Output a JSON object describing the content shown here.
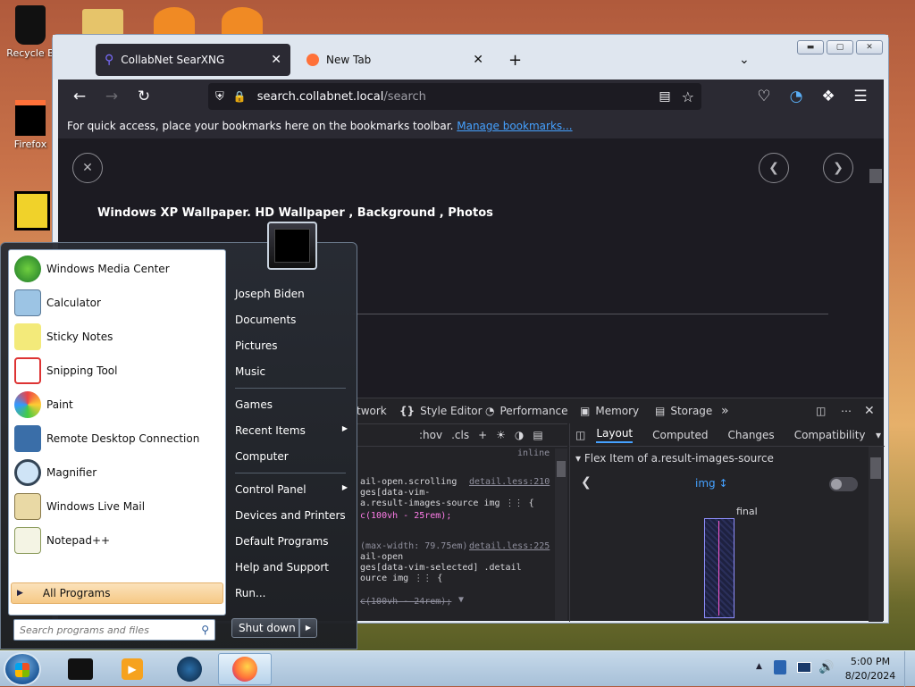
{
  "desktop": {
    "icons": [
      {
        "label": "Recycle B",
        "icon": "recycle-bin-icon"
      },
      {
        "label": "Firefox",
        "icon": "firefox-icon"
      }
    ]
  },
  "browser": {
    "tabs": [
      {
        "label": "CollabNet SearXNG",
        "active": true
      },
      {
        "label": "New Tab",
        "active": false
      }
    ],
    "new_tab": "+",
    "url_host": "search.collabnet.local",
    "url_path": "/search",
    "bookmarks_text": "For quick access, place your bookmarks here on the bookmarks toolbar.",
    "bookmarks_link": "Manage bookmarks...",
    "result_title": "Windows XP Wallpaper. HD Wallpaper , Background , Photos"
  },
  "devtools": {
    "tabs": [
      "twork",
      "Style Editor",
      "Performance",
      "Memory",
      "Storage"
    ],
    "toolbar": [
      ":hov",
      ".cls"
    ],
    "inline": "inline",
    "rules": [
      {
        "sel": "ail-open.scrolling",
        "src": "detail.less:210"
      },
      {
        "sel": "ges[data-vim-",
        "src": ""
      },
      {
        "sel": "a.result-images-source img ⋮⋮ {",
        "src": ""
      },
      {
        "sel": "c(100vh - 25rem);",
        "src": ""
      },
      {
        "sel": "(max-width: 79.75em)",
        "src": "detail.less:225"
      },
      {
        "sel": "ail-open",
        "src": ""
      },
      {
        "sel": "ges[data-vim-selected] .detail",
        "src": ""
      },
      {
        "sel": "ource img ⋮⋮ {",
        "src": ""
      },
      {
        "sel": "c(100vh - 24rem);",
        "src": ""
      }
    ],
    "layout_tabs": [
      "Layout",
      "Computed",
      "Changes",
      "Compatibility"
    ],
    "flex_item": "Flex Item of a.result-images-source",
    "selector": "img",
    "final_label": "final"
  },
  "startmenu": {
    "programs": [
      "Windows Media Center",
      "Calculator",
      "Sticky Notes",
      "Snipping Tool",
      "Paint",
      "Remote Desktop Connection",
      "Magnifier",
      "Windows Live Mail",
      "Notepad++"
    ],
    "all_programs": "All Programs",
    "search_placeholder": "Search programs and files",
    "right": [
      "Joseph Biden",
      "Documents",
      "Pictures",
      "Music",
      "Games",
      "Recent Items",
      "Computer",
      "Control Panel",
      "Devices and Printers",
      "Default Programs",
      "Help and Support",
      "Run..."
    ],
    "shutdown": "Shut down"
  },
  "taskbar": {
    "time": "5:00 PM",
    "date": "8/20/2024"
  },
  "colors": {
    "firefox_dark": "#2b2a33",
    "link": "#45a1ff",
    "taskbar": "#a7c0d8"
  }
}
